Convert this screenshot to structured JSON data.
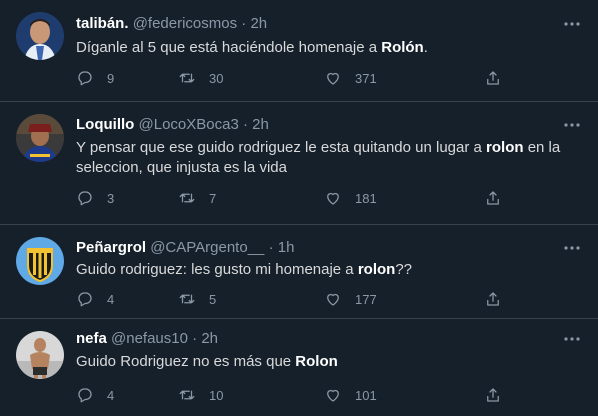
{
  "tweets": [
    {
      "name": "talibán.",
      "handle": "@federicosmos",
      "time": "2h",
      "sep": "·",
      "text_pre": "Díganle al 5 que está haciéndole homenaje a ",
      "text_bold": "Rolón",
      "text_post": ".",
      "replies": "9",
      "retweets": "30",
      "likes": "371"
    },
    {
      "name": "Loquillo",
      "handle": "@LocoXBoca3",
      "time": "2h",
      "sep": "·",
      "text_pre": "Y pensar que ese guido rodriguez le esta quitando un lugar a ",
      "text_bold": "rolon",
      "text_post": " en la seleccion, que injusta es la vida",
      "replies": "3",
      "retweets": "7",
      "likes": "181"
    },
    {
      "name": "Peñargrol",
      "handle": "@CAPArgento__",
      "time": "1h",
      "sep": "·",
      "text_pre": "Guido rodriguez: les gusto mi homenaje a ",
      "text_bold": "rolon",
      "text_post": "??",
      "replies": "4",
      "retweets": "5",
      "likes": "177"
    },
    {
      "name": "nefa",
      "handle": "@nefaus10",
      "time": "2h",
      "sep": "·",
      "text_pre": "Guido Rodriguez no es más que ",
      "text_bold": "Rolon",
      "text_post": "",
      "replies": "4",
      "retweets": "10",
      "likes": "101"
    }
  ],
  "colors": {
    "background": "#15202b",
    "divider": "#38444d",
    "secondary_text": "#8b98a5",
    "primary_text": "#d9d9d9"
  },
  "icons": [
    "reply-icon",
    "retweet-icon",
    "like-icon",
    "share-icon",
    "more-icon"
  ]
}
